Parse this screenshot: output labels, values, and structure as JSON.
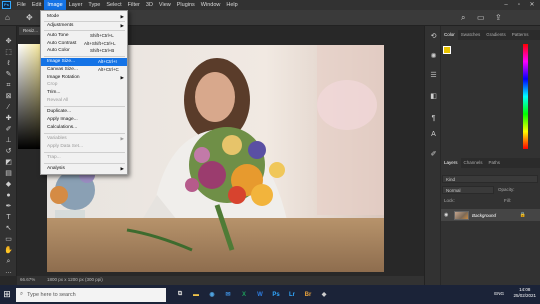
{
  "menubar": {
    "app_logo": "Ps",
    "items": [
      "File",
      "Edit",
      "Image",
      "Layer",
      "Type",
      "Select",
      "Filter",
      "3D",
      "View",
      "Plugins",
      "Window",
      "Help"
    ],
    "active_index": 2
  },
  "document": {
    "tab_title": "Resiz..."
  },
  "image_menu": {
    "mode": "Mode",
    "adjustments": "Adjustments",
    "auto_tone": "Auto Tone",
    "auto_tone_sc": "Shift+Ctrl+L",
    "auto_contrast": "Auto Contrast",
    "auto_contrast_sc": "Alt+Shift+Ctrl+L",
    "auto_color": "Auto Color",
    "auto_color_sc": "Shift+Ctrl+B",
    "image_size": "Image Size...",
    "image_size_sc": "Alt+Ctrl+I",
    "canvas_size": "Canvas Size...",
    "canvas_size_sc": "Alt+Ctrl+C",
    "image_rotation": "Image Rotation",
    "crop": "Crop",
    "trim": "Trim...",
    "reveal_all": "Reveal All",
    "duplicate": "Duplicate...",
    "apply_image": "Apply Image...",
    "calculations": "Calculations...",
    "variables": "Variables",
    "apply_data_set": "Apply Data Set...",
    "trap": "Trap...",
    "analysis": "Analysis"
  },
  "status": {
    "zoom": "66.67%",
    "info": "1800 px x 1200 px (300 ppi)"
  },
  "color_panel": {
    "tabs": [
      "Color",
      "Swatches",
      "Gradients",
      "Patterns"
    ],
    "fg": "#e8c300",
    "bg": "#000000"
  },
  "layers_panel": {
    "tabs": [
      "Layers",
      "Channels",
      "Paths"
    ],
    "kind": "Kind",
    "blend": "Normal",
    "opacity_label": "Opacity:",
    "lock_label": "Lock:",
    "fill_label": "Fill:",
    "layer_name": "Background"
  },
  "taskbar": {
    "search_placeholder": "Type here to search",
    "time": "14:08",
    "date": "25/02/2021",
    "lang": "ENG",
    "apps": [
      "Ps",
      "Lr",
      "Br"
    ]
  },
  "colors": {
    "accent": "#1473e6",
    "ps_blue": "#31a8ff"
  }
}
